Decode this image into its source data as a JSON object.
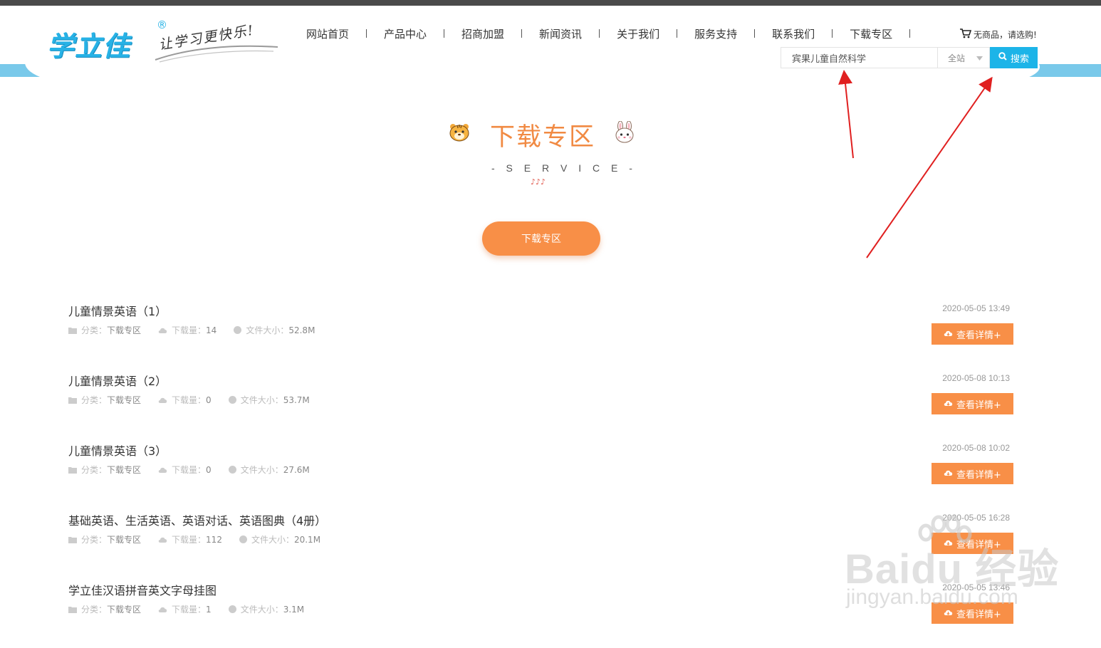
{
  "brand": {
    "logo_text": "学立佳",
    "registered_mark": "®",
    "slogan": "让学习更快乐!"
  },
  "nav": {
    "items": [
      "网站首页",
      "产品中心",
      "招商加盟",
      "新闻资讯",
      "关于我们",
      "服务支持",
      "联系我们",
      "下载专区"
    ]
  },
  "cart": {
    "text": "无商品，请选购!"
  },
  "search": {
    "value": "宾果儿童自然科学",
    "scope": "全站",
    "button_label": "搜索"
  },
  "section": {
    "title": "下载专区",
    "subtitle": "- S E R V I C E -",
    "notes": "♪♪♪",
    "pill_label": "下载专区"
  },
  "labels": {
    "category": "分类：",
    "downloads": "下载量：",
    "size": "文件大小：",
    "detail_button": "查看详情+"
  },
  "items": [
    {
      "title": "儿童情景英语（1）",
      "category": "下载专区",
      "downloads": "14",
      "size": "52.8M",
      "date": "2020-05-05 13:49"
    },
    {
      "title": "儿童情景英语（2）",
      "category": "下载专区",
      "downloads": "0",
      "size": "53.7M",
      "date": "2020-05-08 10:13"
    },
    {
      "title": "儿童情景英语（3）",
      "category": "下载专区",
      "downloads": "0",
      "size": "27.6M",
      "date": "2020-05-08 10:02"
    },
    {
      "title": "基础英语、生活英语、英语对话、英语图典（4册）",
      "category": "下载专区",
      "downloads": "112",
      "size": "20.1M",
      "date": "2020-05-05 16:28"
    },
    {
      "title": "学立佳汉语拼音英文字母挂图",
      "category": "下载专区",
      "downloads": "1",
      "size": "3.1M",
      "date": "2020-05-05 13:46"
    }
  ],
  "watermark": {
    "main": "Baidu 经验",
    "sub": "jingyan.baidu.com"
  },
  "colors": {
    "accent_orange": "#f88f47",
    "accent_blue": "#1cb4e8",
    "title_orange": "#f18a43",
    "annotation_red": "#e02020"
  }
}
